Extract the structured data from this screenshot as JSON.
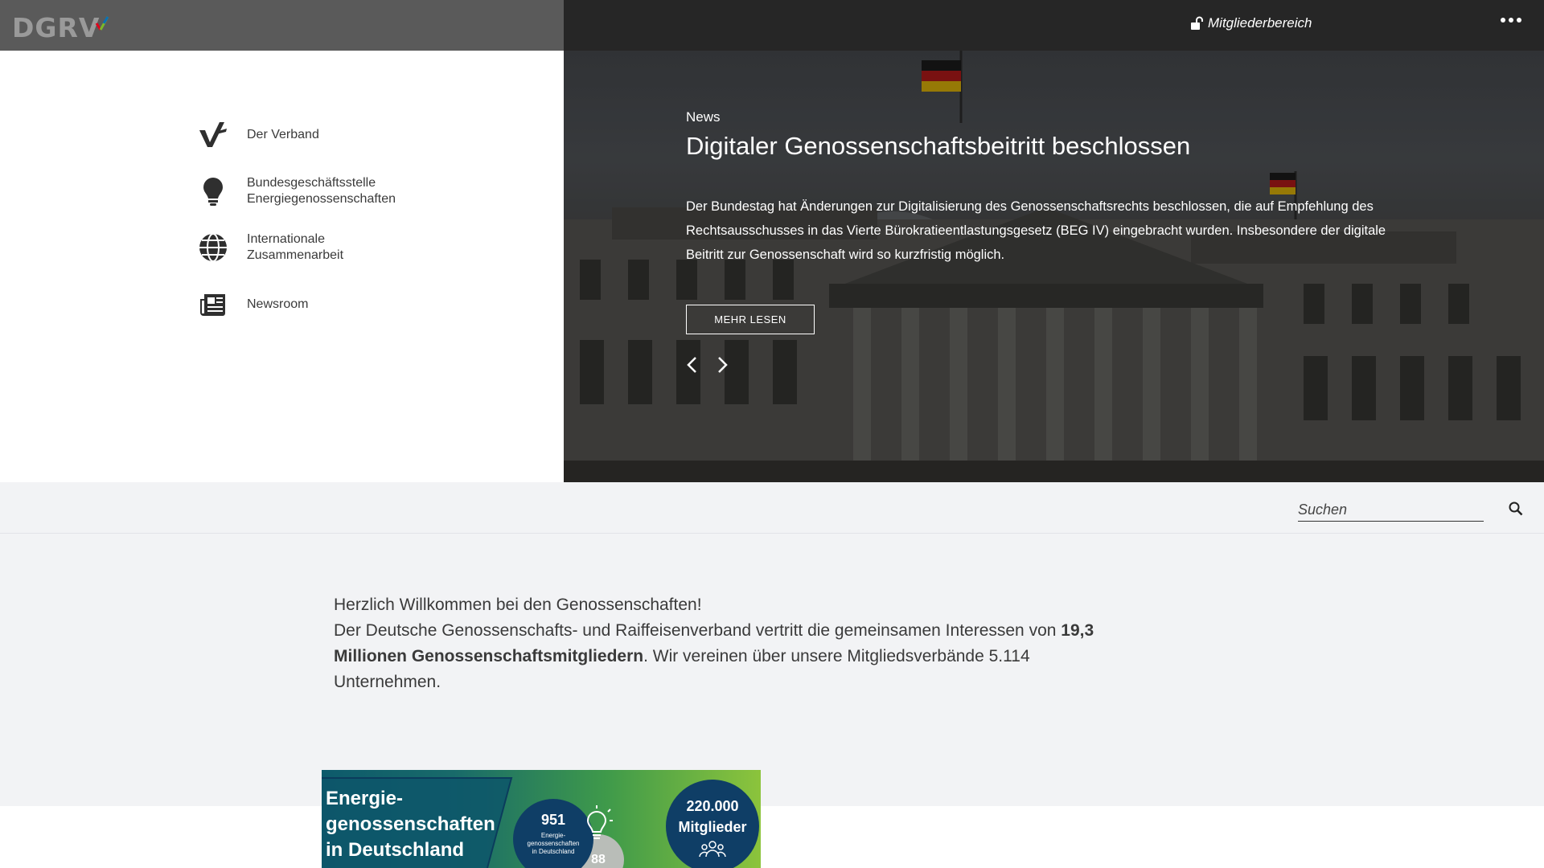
{
  "header": {
    "logo_text": "DGRV",
    "members_label": "Mitgliederbereich",
    "more_icon": "ellipsis-icon"
  },
  "nav": {
    "items": [
      {
        "label": "Der Verband",
        "icon": "dgrv-v-icon"
      },
      {
        "label": "Bundesgeschäftsstelle Energiegenossenschaften",
        "icon": "lightbulb-icon"
      },
      {
        "label": "Internationale Zusammenarbeit",
        "icon": "globe-icon"
      },
      {
        "label": "Newsroom",
        "icon": "newspaper-icon"
      }
    ]
  },
  "hero": {
    "kicker": "News",
    "title": "Digitaler Genossenschaftsbeitritt beschlossen",
    "text": "Der Bundestag hat Änderungen zur Digitalisierung des Genossenschaftsrechts beschlossen, die auf Empfehlung des Rechtsausschusses in das Vierte Bürokratieentlastungsgesetz (BEG IV) eingebracht wurden. Insbesondere der digitale Beitritt zur Genossenschaft wird so kurzfristig möglich.",
    "button_label": "MEHR LESEN"
  },
  "search": {
    "placeholder": "Suchen"
  },
  "welcome": {
    "line1": "Herzlich Willkommen bei den Genossenschaften!",
    "line2_pre": "Der Deutsche Genossenschafts- und Raiffeisenverband vertritt die gemeinsamen Interessen von ",
    "line2_bold": "19,3 Millionen Genossenschaftsmitgliedern",
    "line2_post": ". Wir vereinen über unsere Mitgliedsverbände 5.114 Unternehmen."
  },
  "infographic": {
    "title_line1": "Energie-",
    "title_line2": "genossenschaften",
    "title_line3": "in Deutschland",
    "count1": "951",
    "count1_label_line1": "Energie-",
    "count1_label_line2": "genossenschaften",
    "count1_label_line3": "in Deutschland",
    "count2": "88",
    "count3_line1": "220.000",
    "count3_line2": "Mitglieder"
  },
  "colors": {
    "topbar_left": "#5a5a5a",
    "topbar_right": "#262626",
    "page_bg": "#f2f3f5"
  }
}
